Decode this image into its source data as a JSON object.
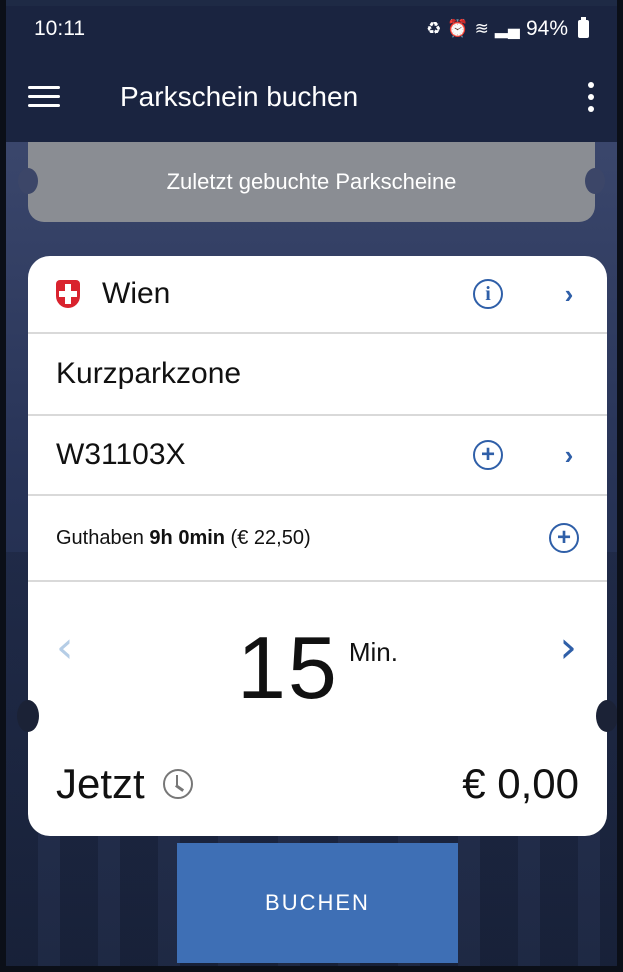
{
  "status_bar": {
    "time": "10:11",
    "battery": "94%"
  },
  "app_bar": {
    "title": "Parkschein buchen"
  },
  "recent": {
    "label": "Zuletzt gebuchte Parkscheine"
  },
  "card": {
    "city": "Wien",
    "zone": "Kurzparkzone",
    "plate": "W31103X",
    "balance": {
      "prefix": "Guthaben ",
      "time": "9h 0min",
      "amount": " (€ 22,50)"
    },
    "duration": {
      "value": "15",
      "unit": "Min."
    },
    "start": "Jetzt",
    "price": "€ 0,00"
  },
  "action": {
    "book_label": "BUCHEN"
  },
  "colors": {
    "accent": "#2f5fa8",
    "button": "#3e6fb5",
    "app_bar": "#1a2440",
    "recent_bg": "#8a8d93"
  }
}
